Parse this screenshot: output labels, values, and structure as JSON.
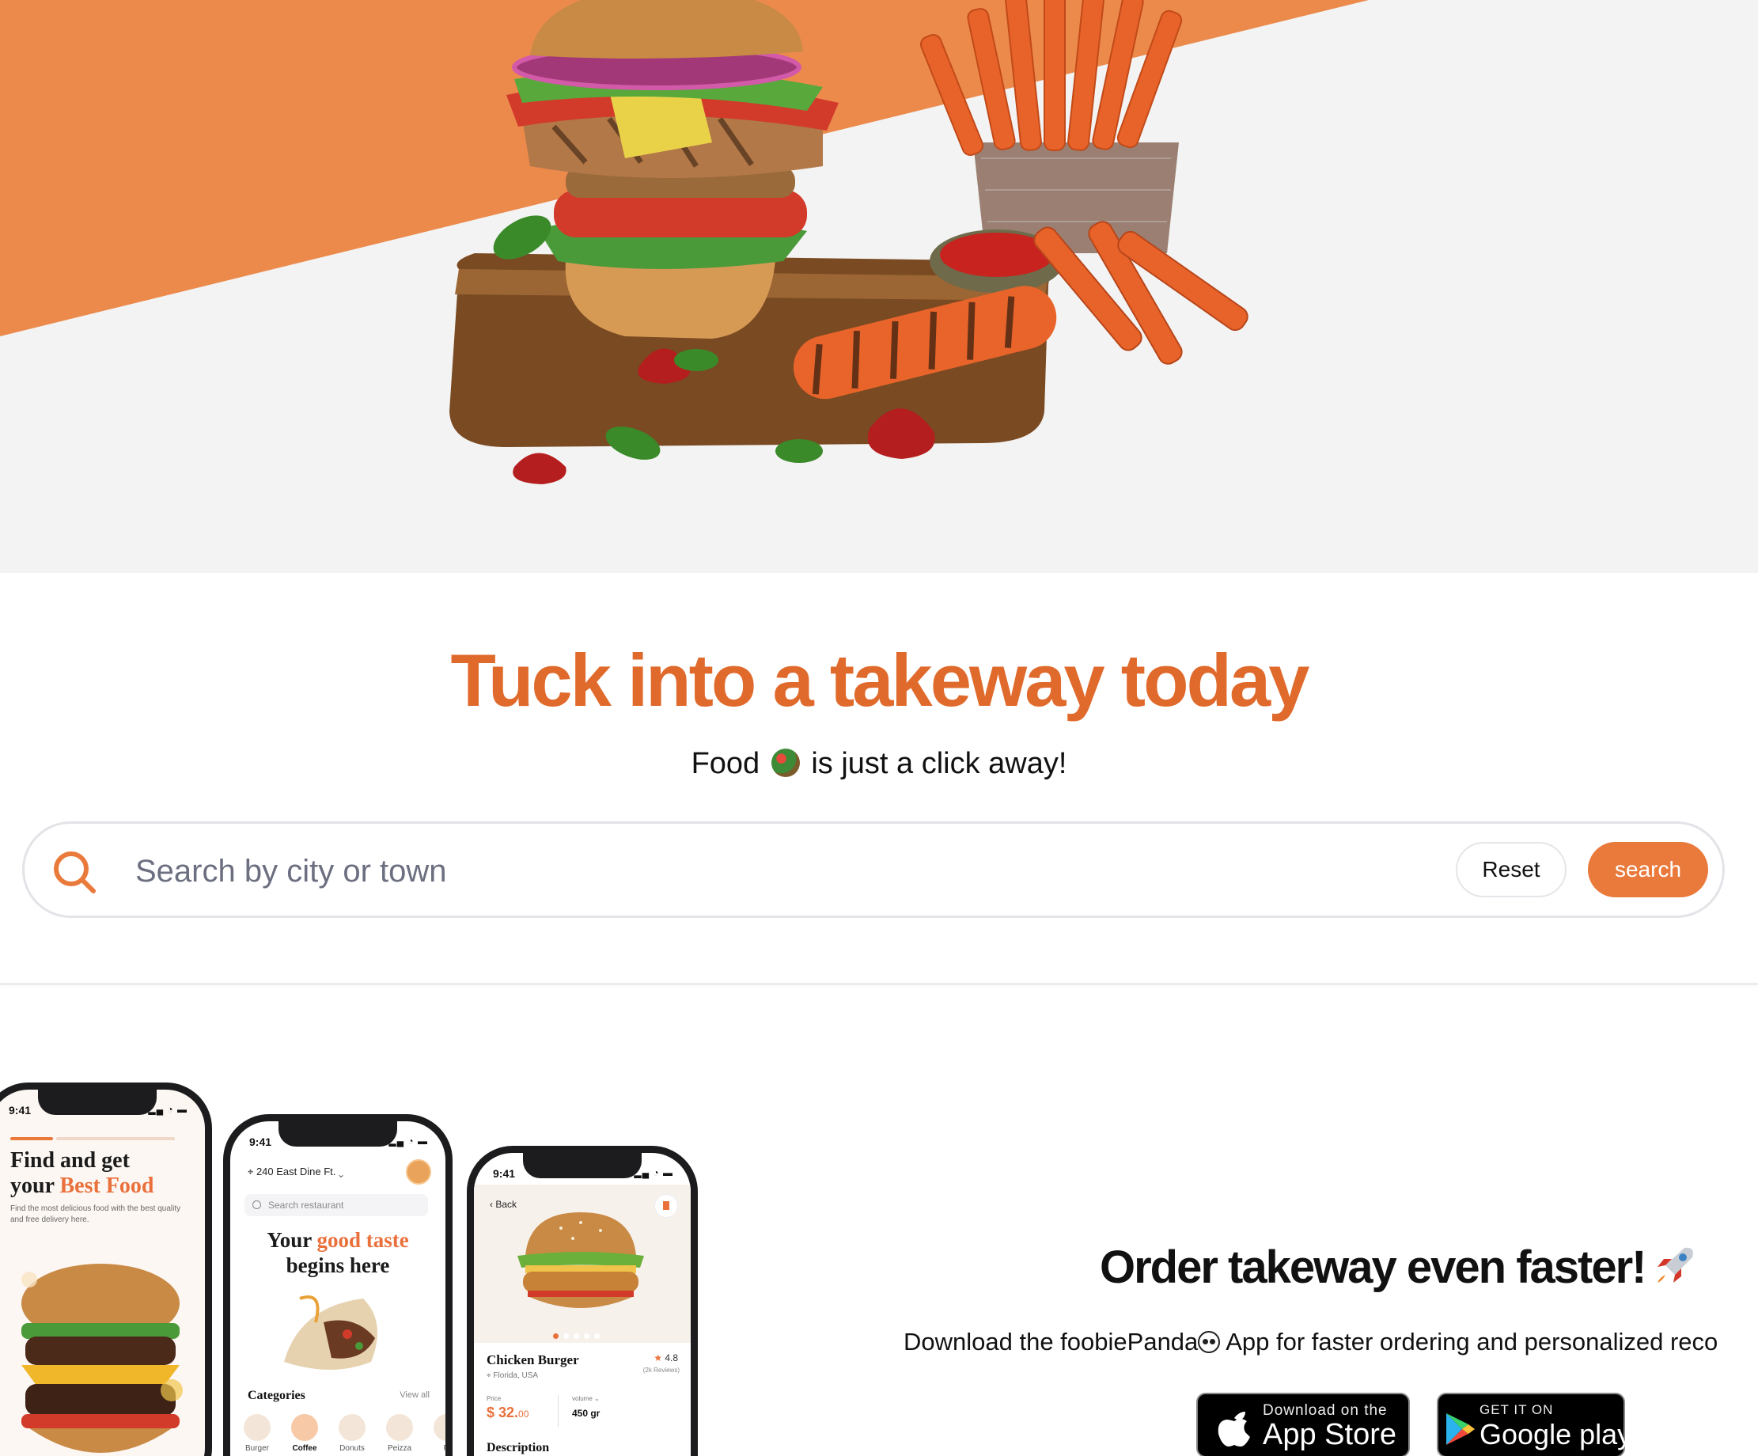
{
  "hero": {
    "accent_color": "#ec8a4c",
    "background_color": "#f3f3f3",
    "image": "burger-and-fries-illustration"
  },
  "search_section": {
    "headline": "Tuck into a takeway today",
    "subline_before": "Food",
    "subline_emoji": "salad-emoji",
    "subline_after": "is just a click away!",
    "search_icon": "search-icon",
    "search_placeholder": "Search by city or town",
    "reset_label": "Reset",
    "search_label": "search",
    "accent_color": "#e97a3c",
    "headline_color": "#e06a2c"
  },
  "promo": {
    "title": "Order takeway even faster!",
    "title_emoji": "rocket-icon",
    "subtitle_before": "Download the foobiePanda",
    "subtitle_emoji": "panda-icon",
    "subtitle_after": " App for faster ordering and personalized reco",
    "app_store": {
      "small": "Download on the",
      "big": "App Store",
      "icon": "apple-icon"
    },
    "google_play": {
      "small": "GET IT ON",
      "big": "Google play",
      "icon": "google-play-icon"
    },
    "phone1": {
      "time": "9:41",
      "title_line1": "Find and get",
      "title_line2_before": "your ",
      "title_line2_accent": "Best Food",
      "description": "Find the most delicious food with the best quality and free delivery here."
    },
    "phone2": {
      "time": "9:41",
      "location": "240 East Dine Ft.",
      "search_placeholder": "Search restaurant",
      "title_before": "Your ",
      "title_accent": "good taste",
      "title_after": "begins here",
      "categories_label": "Categories",
      "view_all": "View all",
      "categories": [
        "Burger",
        "Coffee",
        "Donuts",
        "Peizza",
        "Pi"
      ]
    },
    "phone3": {
      "time": "9:41",
      "back": "Back",
      "name": "Chicken Burger",
      "location": "Florida, USA",
      "rating": "4.8",
      "reviews": "(2k Reviews)",
      "price_label": "Price",
      "price": "$ 32.",
      "price_cents": "00",
      "volume_label": "volume",
      "volume": "450 gr",
      "description_label": "Description"
    }
  }
}
